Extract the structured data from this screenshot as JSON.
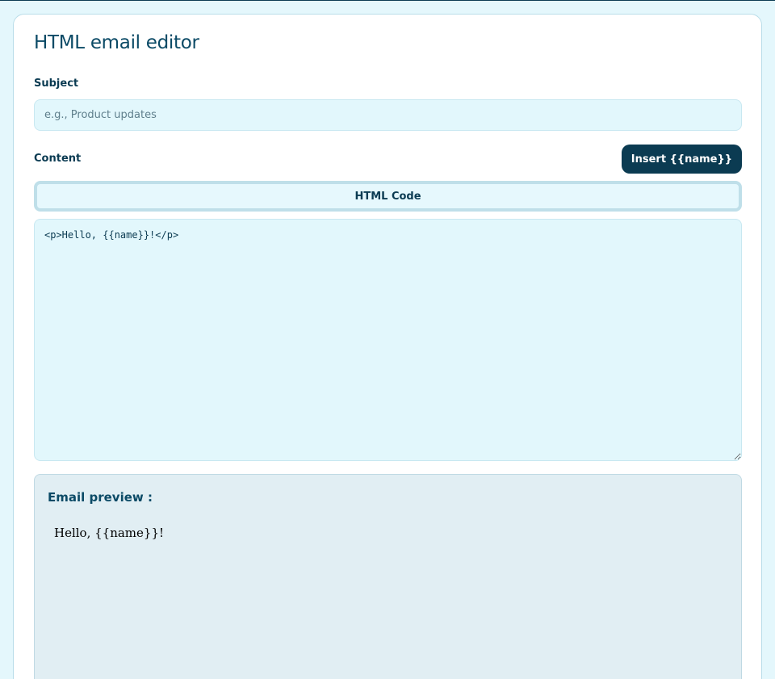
{
  "editor": {
    "title": "HTML email editor",
    "subject_label": "Subject",
    "subject_placeholder": "e.g., Product updates",
    "subject_value": "",
    "content_label": "Content",
    "insert_button_label": "Insert {{name}}",
    "tab_label": "HTML Code",
    "code_value": "<p>Hello, {{name}}!</p>"
  },
  "preview": {
    "title": "Email preview :",
    "body_text": "Hello, {{name}}!"
  }
}
